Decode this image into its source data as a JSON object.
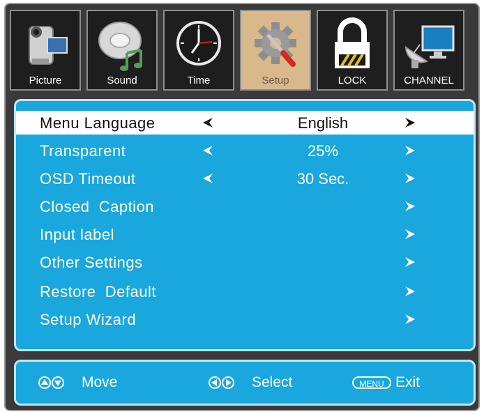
{
  "tabs": [
    {
      "label": "Picture",
      "icon": "camcorder-icon",
      "active": false
    },
    {
      "label": "Sound",
      "icon": "music-disc-icon",
      "active": false
    },
    {
      "label": "Time",
      "icon": "clock-icon",
      "active": false
    },
    {
      "label": "Setup",
      "icon": "gear-wrench-icon",
      "active": true
    },
    {
      "label": "LOCK",
      "icon": "padlock-icon",
      "active": false
    },
    {
      "label": "CHANNEL",
      "icon": "satellite-monitor-icon",
      "active": false
    }
  ],
  "menu": {
    "rows": [
      {
        "label": "Menu Language",
        "value": "English",
        "selected": true
      },
      {
        "label": "Transparent",
        "value": "25%"
      },
      {
        "label": "OSD Timeout",
        "value": "30 Sec."
      },
      {
        "label": "Closed  Caption"
      },
      {
        "label": "Input label"
      },
      {
        "label": "Other Settings"
      },
      {
        "label": "Restore  Default"
      },
      {
        "label": "Setup Wizard"
      }
    ]
  },
  "footer": {
    "move_label": "Move",
    "select_label": "Select",
    "menu_key": "MENU",
    "exit_label": "Exit"
  },
  "colors": {
    "panel": "#1aa7de",
    "panel_border": "#bfe6f6",
    "frame": "#3a3a3a",
    "active_tab": "#d8b98c",
    "selected_row": "#ffffff"
  }
}
